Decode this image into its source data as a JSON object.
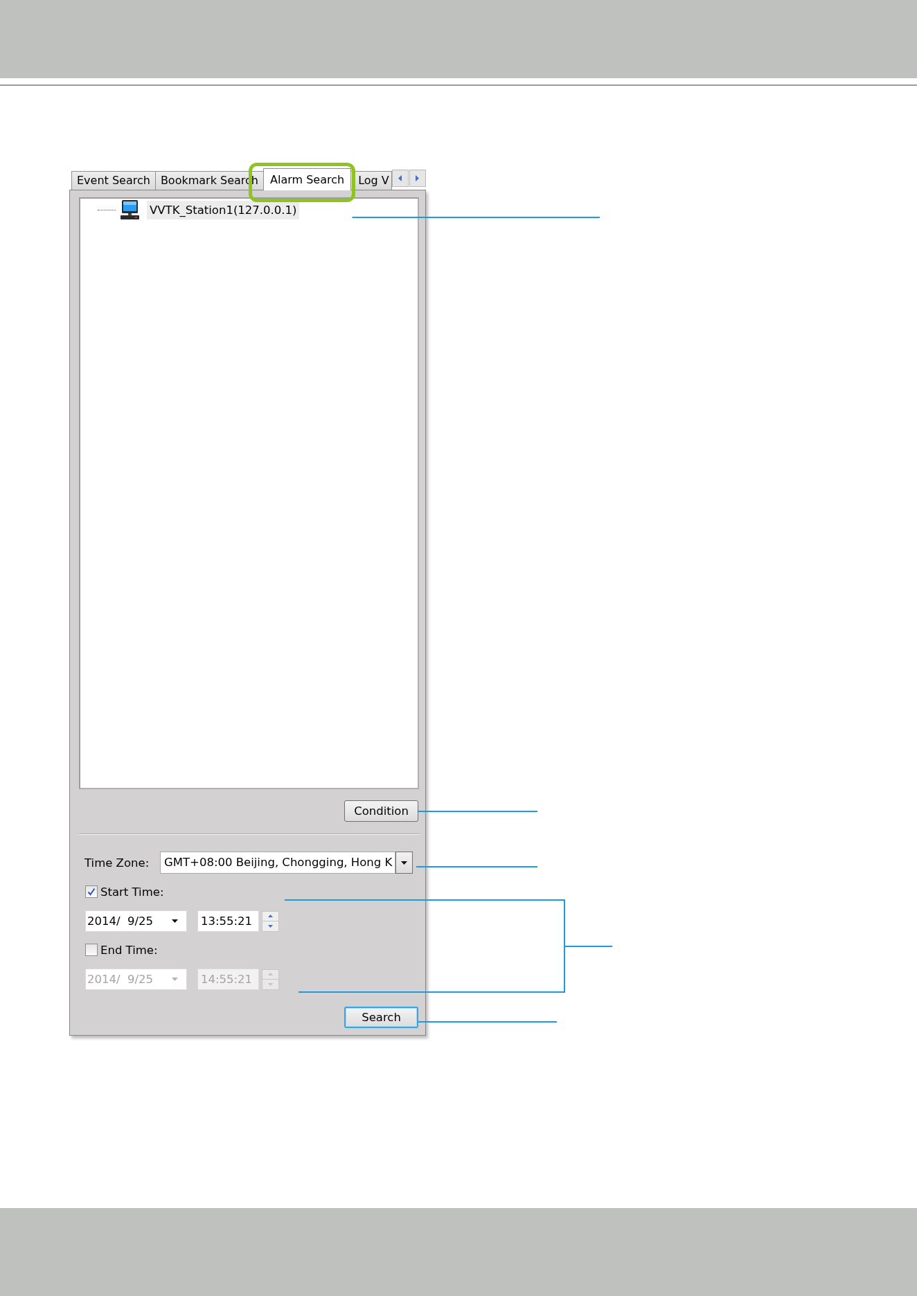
{
  "tabs": [
    {
      "label": "Event Search",
      "selected": false,
      "highlighted": false
    },
    {
      "label": "Bookmark Search",
      "selected": false,
      "highlighted": false
    },
    {
      "label": "Alarm Search",
      "selected": true,
      "highlighted": true
    },
    {
      "label": "Log V",
      "selected": false,
      "highlighted": false
    }
  ],
  "tree": {
    "items": [
      {
        "label": "VVTK_Station1(127.0.0.1)",
        "selected": true
      }
    ]
  },
  "condition_button": {
    "label": "Condition"
  },
  "time_zone": {
    "label": "Time Zone:",
    "value": "GMT+08:00 Beijing, Chongging, Hong K"
  },
  "start_time": {
    "label": "Start Time:",
    "checked": true,
    "date": "2014/  9/25",
    "time": "13:55:21"
  },
  "end_time": {
    "label": "End Time:",
    "checked": false,
    "date": "2014/  9/25",
    "time": "14:55:21"
  },
  "search_button": {
    "label": "Search",
    "focused": true
  }
}
